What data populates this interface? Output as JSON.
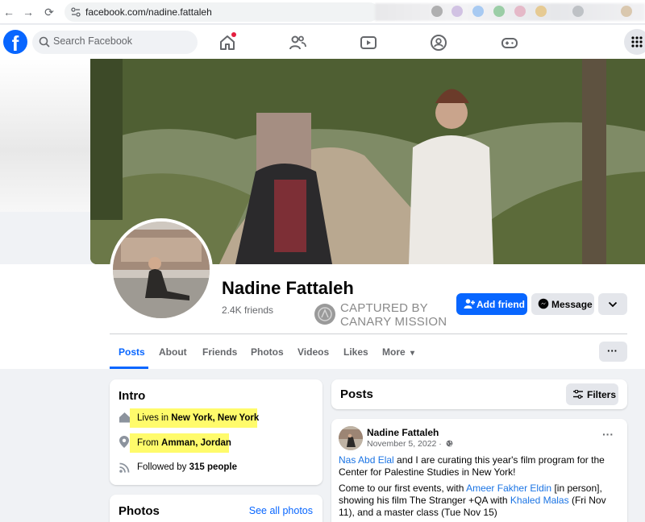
{
  "browser": {
    "url": "facebook.com/nadine.fattaleh",
    "back": "←",
    "forward": "→",
    "reload": "⟳"
  },
  "header": {
    "logo": "f",
    "search_placeholder": "Search Facebook"
  },
  "profile": {
    "name": "Nadine Fattaleh",
    "friends": "2.4K friends",
    "watermark_line1": "CAPTURED BY",
    "watermark_line2": "CANARY MISSION",
    "add_friend": "Add friend",
    "message": "Message"
  },
  "tabs": {
    "posts": "Posts",
    "about": "About",
    "friends": "Friends",
    "photos": "Photos",
    "videos": "Videos",
    "likes": "Likes",
    "more": "More",
    "more_caret": "▾",
    "dots": "···"
  },
  "intro": {
    "title": "Intro",
    "lives_prefix": "Lives in ",
    "lives_place": "New York, New York",
    "from_prefix": "From ",
    "from_place": "Amman, Jordan",
    "followed_prefix": "Followed by ",
    "followed_count": "315 people"
  },
  "photos_card": {
    "title": "Photos",
    "see_all": "See all photos"
  },
  "posts": {
    "title": "Posts",
    "filters": "Filters",
    "author": "Nadine Fattaleh",
    "date": "November 5, 2022 ·",
    "menu": "···",
    "p1_link": "Nas Abd Elal",
    "p1_text": " and I are curating this year's film program for the Center for Palestine Studies in New York!",
    "p2_a": "Come to our first events, with ",
    "p2_link1": "Ameer Fakher Eldin",
    "p2_b": " [in person], showing his film The Stranger +QA with ",
    "p2_link2": "Khaled Malas",
    "p2_c": " (Fri Nov 11), and a master class (Tue Nov 15)"
  },
  "colors": {
    "brand": "#0866ff",
    "highlight": "#fffb6b",
    "background": "#f0f2f5"
  }
}
